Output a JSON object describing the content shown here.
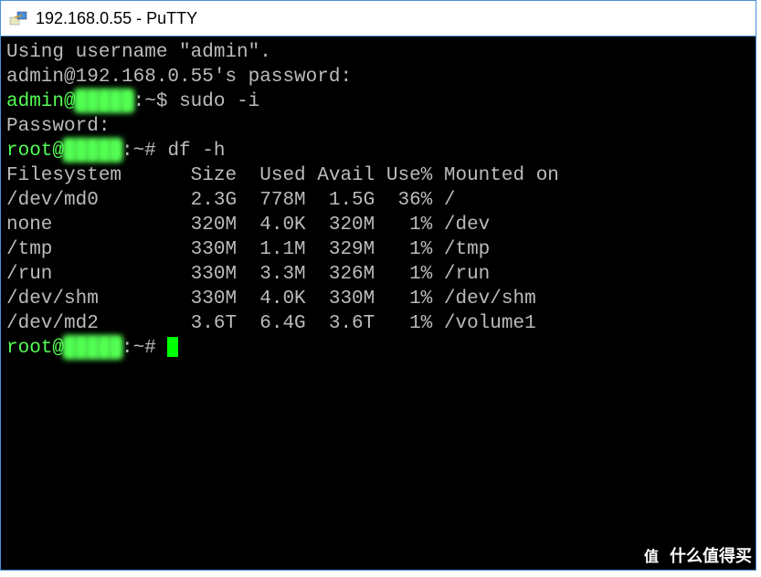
{
  "window": {
    "title": "192.168.0.55 - PuTTY"
  },
  "terminal": {
    "line_username": "Using username \"admin\".",
    "line_password_prompt": "admin@192.168.0.55's password:",
    "prompt1_user": "admin@",
    "prompt1_host_masked": "█████",
    "prompt1_path": ":~$ ",
    "prompt1_cmd": "sudo -i",
    "line_password": "Password:",
    "prompt2_user": "root@",
    "prompt2_host_masked": "█████",
    "prompt2_path": ":~# ",
    "prompt2_cmd": "df -h",
    "header": "Filesystem      Size  Used Avail Use% Mounted on",
    "rows": [
      "/dev/md0        2.3G  778M  1.5G  36% /",
      "none            320M  4.0K  320M   1% /dev",
      "/tmp            330M  1.1M  329M   1% /tmp",
      "/run            330M  3.3M  326M   1% /run",
      "/dev/shm        330M  4.0K  330M   1% /dev/shm",
      "/dev/md2        3.6T  6.4G  3.6T   1% /volume1"
    ],
    "prompt3_user": "root@",
    "prompt3_host_masked": "█████",
    "prompt3_path": ":~# "
  },
  "watermark": {
    "badge": "值",
    "text": "什么值得买"
  }
}
